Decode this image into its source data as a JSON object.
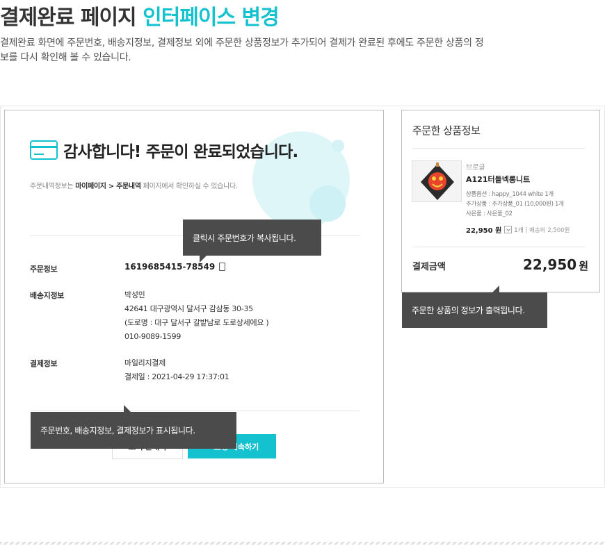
{
  "page": {
    "title": "결제완료 페이지",
    "title_accent": "인터페이스 변경",
    "description": "결제완료 화면에 주문번호, 배송지정보, 결제정보 외에 주문한 상품정보가 추가되어 결제가 완료된 후에도 주문한 상품의 정보를 다시 확인해 볼 수 있습니다."
  },
  "order": {
    "thanks": "감사합니다! 주문이 완료되었습니다.",
    "notice_prefix": "주문내역정보는 ",
    "notice_path": "마이페이지 > 주문내역",
    "notice_suffix": " 페이지에서 확인하실 수 있습니다.",
    "order_label": "주문정보",
    "order_number": "1619685415-78549",
    "shipping_label": "배송지정보",
    "shipping_name": "박성민",
    "shipping_address": "42641 대구광역시 달서구 감삼동 30-35",
    "shipping_road": "(도로명 : 대구 달서구 갈밭남로 도로상세에요 )",
    "shipping_phone": "010-9089-1599",
    "payment_label": "결제정보",
    "payment_method": "마일리지결제",
    "payment_date": "결제일 : 2021-04-29 17:37:01",
    "btn_history": "주문내역",
    "btn_continue": "✓ 쇼핑 계속하기"
  },
  "product_panel": {
    "title": "주문한 상품정보",
    "brand": "브로글",
    "name": "A121터들넥롱니트",
    "option": "상품옵션 : happy_1044 white 1개",
    "addon": "추가상품 : 추가상품_01 (10,000원) 1개",
    "gift": "사은품 : 사은품_02",
    "price": "22,950 원",
    "qty": "1개",
    "shipping_fee": "| 배송비 2,500원",
    "total_label": "결제금액",
    "total_value": "22,950",
    "total_unit": "원"
  },
  "tooltips": {
    "copy": "클릭시 주문번호가 복사됩니다.",
    "info": "주문번호, 배송지정보, 결제정보가 표시됩니다.",
    "product": "주문한 상품의 정보가 출력됩니다."
  },
  "colors": {
    "accent": "#13c1cf",
    "tooltip_bg": "#4b4b4b"
  },
  "icons": [
    "card-icon",
    "copy-icon",
    "list-icon",
    "chevron-down-icon"
  ]
}
